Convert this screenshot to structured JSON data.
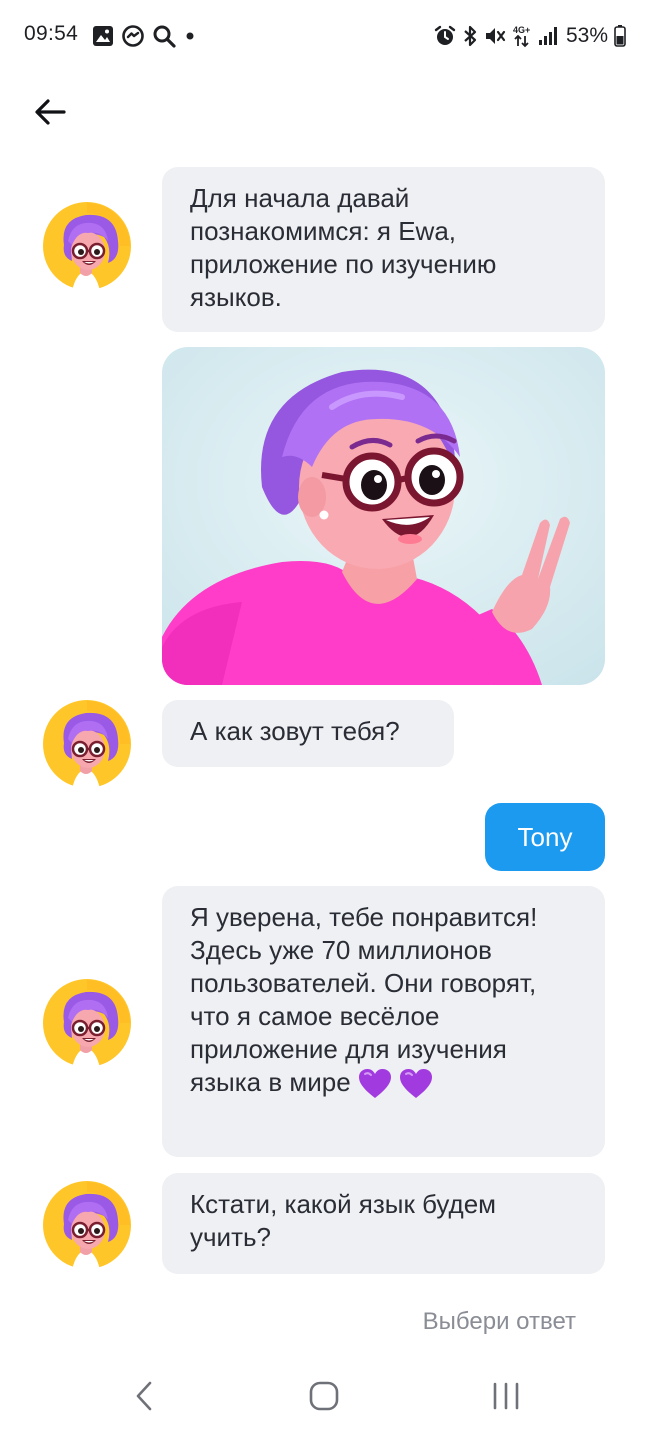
{
  "status_bar": {
    "time": "09:54",
    "battery_percent": "53%",
    "left_icons": [
      "gallery-icon",
      "messenger-icon",
      "search-icon",
      "notification-dot-icon"
    ],
    "right_icons": [
      "alarm-icon",
      "bluetooth-icon",
      "mute-icon",
      "4g-data-icon",
      "signal-icon",
      "battery-icon"
    ]
  },
  "header": {
    "back_icon": "arrow-left-icon"
  },
  "chat": {
    "messages": [
      {
        "sender": "bot",
        "text": "Для начала давай познакомимся: я Ewa, приложение по изучению языков."
      },
      {
        "sender": "bot",
        "type": "image",
        "image_alt": "Ewa character waving"
      },
      {
        "sender": "bot",
        "text": "А как зовут тебя?"
      },
      {
        "sender": "user",
        "text": "Tony"
      },
      {
        "sender": "bot",
        "text": "Я уверена, тебе понравится! Здесь уже 70 миллионов пользователей. Они говорят, что я самое весёлое приложение для изучения языка в мире",
        "emoji": "purple-heart-icon"
      },
      {
        "sender": "bot",
        "text": "Кстати, какой язык будем учить?"
      }
    ],
    "choose_answer_label": "Выбери ответ"
  },
  "colors": {
    "bot_bubble": "#eef0f3",
    "user_bubble": "#1b9af0",
    "avatar_ring": "#ffc327",
    "avatar_hair": "#a062e8",
    "shirt": "#ff3dc8",
    "heart": "#a23bdf"
  },
  "nav_bar": {
    "icons": [
      "nav-back-icon",
      "nav-home-icon",
      "nav-recents-icon"
    ]
  }
}
